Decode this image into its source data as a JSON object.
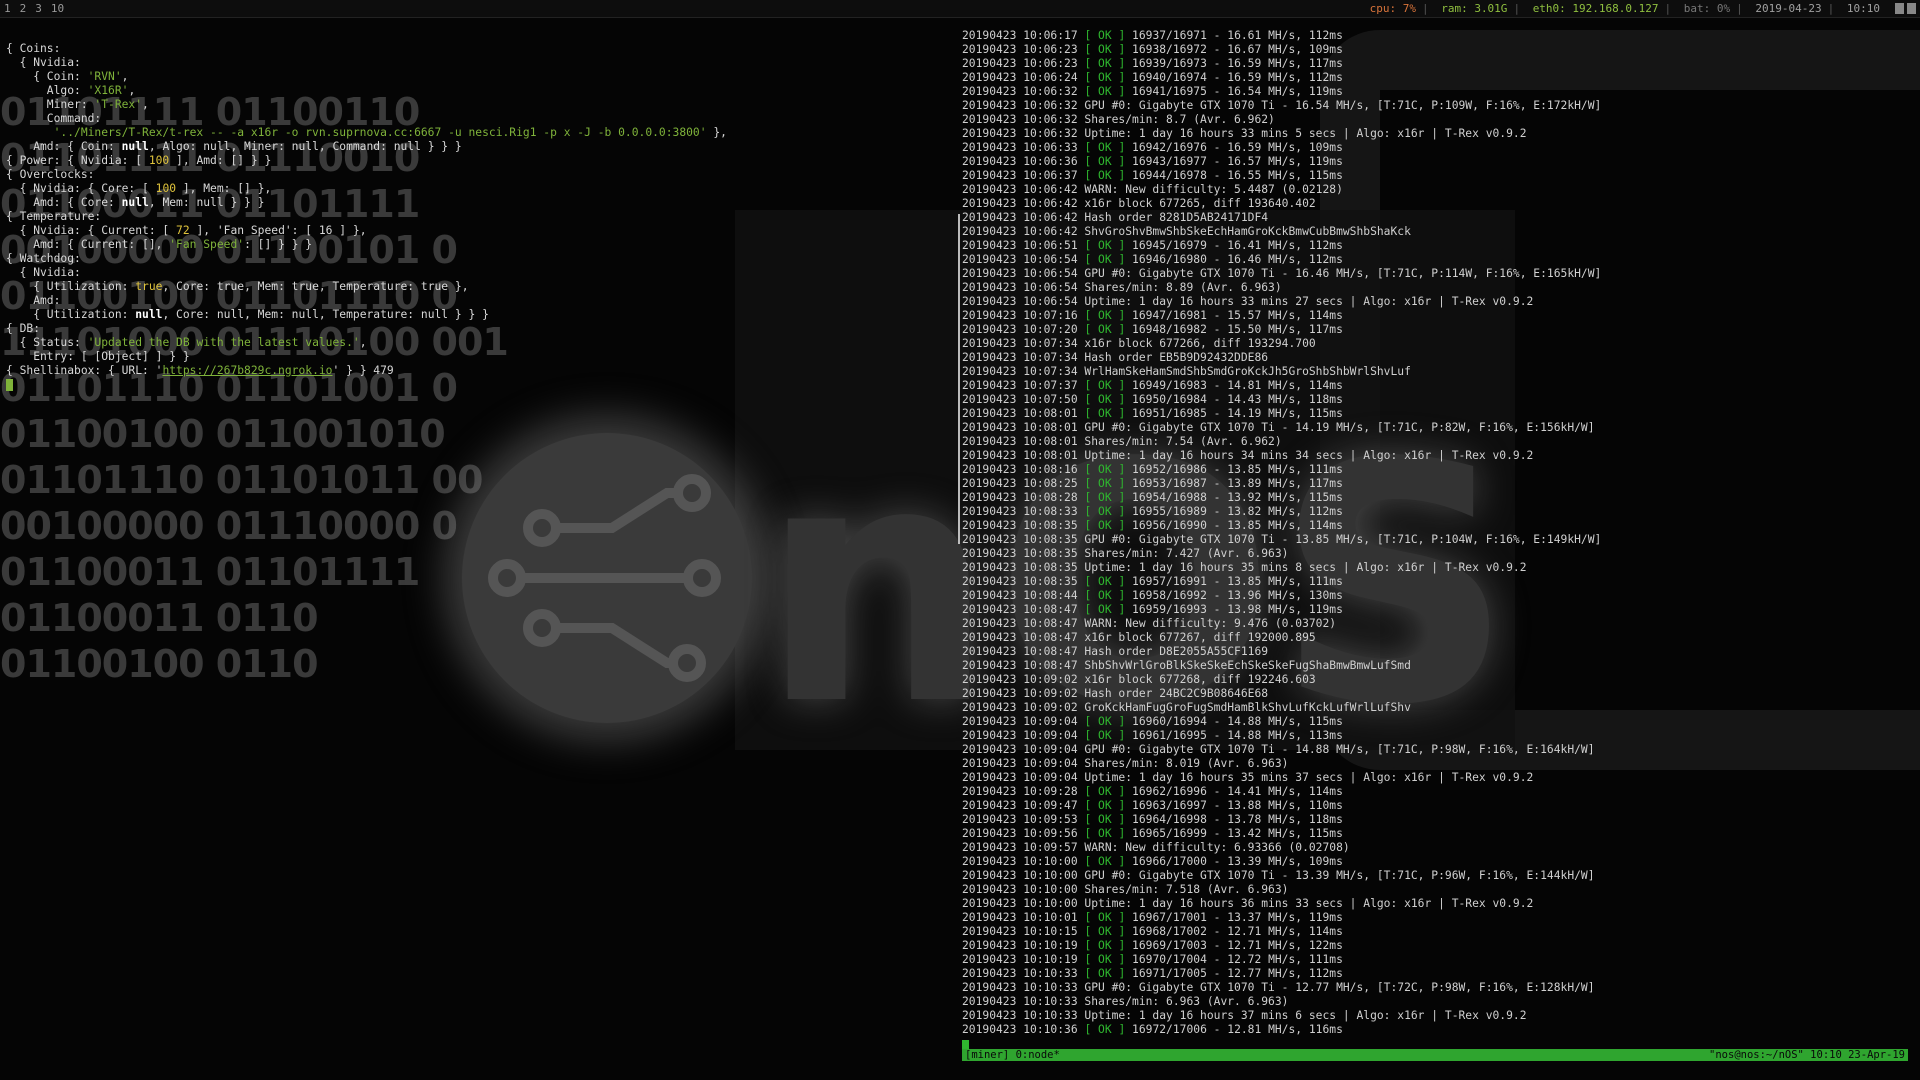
{
  "topbar": {
    "workspaces": [
      "1",
      "2",
      "3",
      "10"
    ],
    "cpu": "cpu: 7%",
    "ram": "ram: 3.01G",
    "eth": "eth0: 192.168.0.127",
    "bat": "bat: 0%",
    "date": "2019-04-23",
    "time": "10:10",
    "colors": {
      "cpu": "#d8733a",
      "ram": "#8fbf3f"
    }
  },
  "wallpaper": {
    "logo_text": "nOS",
    "binary_rows": [
      "01101111 01100110",
      "01101111 01110010",
      "01100011 01101111",
      "00100000 01100101 0",
      "01100100 01101110 0",
      "11101000 01110100 001",
      "01101110 01101001 0",
      "01100100 011001010",
      "01101110 01101011 00",
      "00100000 01110000 0",
      "01100011 01101111",
      "01100011 0110",
      "01100100 0110"
    ]
  },
  "left_pane": {
    "lines": [
      {
        "t": "{ Coins:"
      },
      {
        "t": "  { Nvidia:"
      },
      {
        "t": "    { Coin: ",
        "s": "'RVN'",
        "e": ","
      },
      {
        "t": "      Algo: ",
        "s": "'X16R'",
        "e": ","
      },
      {
        "t": "      Miner: ",
        "s": "'T-Rex'",
        "e": ","
      },
      {
        "t": "      Command:"
      },
      {
        "t": "       ",
        "s": "'../Miners/T-Rex/t-rex -- -a x16r -o rvn.suprnova.cc:6667 -u nesci.Rig1 -p x -J -b 0.0.0.0:3800'",
        "e": " },"
      },
      {
        "t": "    Amd: { Coin: ",
        "b": "null",
        "e": ", Algo: null, Miner: null, Command: null } } }"
      },
      {
        "t": "{ Power: { Nvidia: [ ",
        "n": "100",
        "e": " ], Amd: [] } }"
      },
      {
        "t": "{ Overclocks:"
      },
      {
        "t": "  { Nvidia: { Core: [ ",
        "n": "100",
        "e": " ], Mem: [] },"
      },
      {
        "t": "    Amd: { Core: ",
        "b": "null",
        "e": ", Mem: null } } }"
      },
      {
        "t": "{ Temperature:"
      },
      {
        "t": "  { Nvidia: { Current: [ ",
        "n": "72",
        "e": " ], 'Fan Speed': [ 16 ] },"
      },
      {
        "t": "    Amd: { Current: [], ",
        "s": "'Fan Speed'",
        "e": ": [] } } }"
      },
      {
        "t": "{ Watchdog:"
      },
      {
        "t": "  { Nvidia:"
      },
      {
        "t": "    { Utilization: ",
        "n": "true",
        "e": ", Core: true, Mem: true, Temperature: true },"
      },
      {
        "t": "    Amd:"
      },
      {
        "t": "    { Utilization: ",
        "b": "null",
        "e": ", Core: null, Mem: null, Temperature: null } } }"
      },
      {
        "t": "{ DB:"
      },
      {
        "t": "  { Status: ",
        "s": "'Updated the DB with the latest values.'",
        "e": ","
      },
      {
        "t": "    Entry: [ [Object] ] } }"
      },
      {
        "t": "{ Shellinabox: { URL: '",
        "u": "https://267b829c.ngrok.io",
        "e": "' } } 479"
      }
    ]
  },
  "right_pane": {
    "lines": [
      "20190423 10:06:17 [ OK ] 16937/16971 - 16.61 MH/s, 112ms",
      "20190423 10:06:23 [ OK ] 16938/16972 - 16.67 MH/s, 109ms",
      "20190423 10:06:23 [ OK ] 16939/16973 - 16.59 MH/s, 117ms",
      "20190423 10:06:24 [ OK ] 16940/16974 - 16.59 MH/s, 112ms",
      "20190423 10:06:32 [ OK ] 16941/16975 - 16.54 MH/s, 119ms",
      "20190423 10:06:32 GPU #0: Gigabyte GTX 1070 Ti - 16.54 MH/s, [T:71C, P:109W, F:16%, E:172kH/W]",
      "20190423 10:06:32 Shares/min: 8.7 (Avr. 6.962)",
      "20190423 10:06:32 Uptime: 1 day 16 hours 33 mins 5 secs | Algo: x16r | T-Rex v0.9.2",
      "20190423 10:06:33 [ OK ] 16942/16976 - 16.59 MH/s, 109ms",
      "20190423 10:06:36 [ OK ] 16943/16977 - 16.57 MH/s, 119ms",
      "20190423 10:06:37 [ OK ] 16944/16978 - 16.55 MH/s, 115ms",
      "20190423 10:06:42 WARN: New difficulty: 5.4487 (0.02128)",
      "20190423 10:06:42 x16r block 677265, diff 193640.402",
      "20190423 10:06:42 Hash order 8281D5AB24171DF4",
      "20190423 10:06:42 ShvGroShvBmwShbSkeEchHamGroKckBmwCubBmwShbShaKck",
      "20190423 10:06:51 [ OK ] 16945/16979 - 16.41 MH/s, 112ms",
      "20190423 10:06:54 [ OK ] 16946/16980 - 16.46 MH/s, 112ms",
      "20190423 10:06:54 GPU #0: Gigabyte GTX 1070 Ti - 16.46 MH/s, [T:71C, P:114W, F:16%, E:165kH/W]",
      "20190423 10:06:54 Shares/min: 8.89 (Avr. 6.963)",
      "20190423 10:06:54 Uptime: 1 day 16 hours 33 mins 27 secs | Algo: x16r | T-Rex v0.9.2",
      "20190423 10:07:16 [ OK ] 16947/16981 - 15.57 MH/s, 114ms",
      "20190423 10:07:20 [ OK ] 16948/16982 - 15.50 MH/s, 117ms",
      "20190423 10:07:34 x16r block 677266, diff 193294.700",
      "20190423 10:07:34 Hash order EB5B9D92432DDE86",
      "20190423 10:07:34 WrlHamSkeHamSmdShbSmdGroKckJh5GroShbShbWrlShvLuf",
      "20190423 10:07:37 [ OK ] 16949/16983 - 14.81 MH/s, 114ms",
      "20190423 10:07:50 [ OK ] 16950/16984 - 14.43 MH/s, 118ms",
      "20190423 10:08:01 [ OK ] 16951/16985 - 14.19 MH/s, 115ms",
      "20190423 10:08:01 GPU #0: Gigabyte GTX 1070 Ti - 14.19 MH/s, [T:71C, P:82W, F:16%, E:156kH/W]",
      "20190423 10:08:01 Shares/min: 7.54 (Avr. 6.962)",
      "20190423 10:08:01 Uptime: 1 day 16 hours 34 mins 34 secs | Algo: x16r | T-Rex v0.9.2",
      "20190423 10:08:16 [ OK ] 16952/16986 - 13.85 MH/s, 111ms",
      "20190423 10:08:25 [ OK ] 16953/16987 - 13.89 MH/s, 117ms",
      "20190423 10:08:28 [ OK ] 16954/16988 - 13.92 MH/s, 115ms",
      "20190423 10:08:33 [ OK ] 16955/16989 - 13.82 MH/s, 112ms",
      "20190423 10:08:35 [ OK ] 16956/16990 - 13.85 MH/s, 114ms",
      "20190423 10:08:35 GPU #0: Gigabyte GTX 1070 Ti - 13.85 MH/s, [T:71C, P:104W, F:16%, E:149kH/W]",
      "20190423 10:08:35 Shares/min: 7.427 (Avr. 6.963)",
      "20190423 10:08:35 Uptime: 1 day 16 hours 35 mins 8 secs | Algo: x16r | T-Rex v0.9.2",
      "20190423 10:08:35 [ OK ] 16957/16991 - 13.85 MH/s, 111ms",
      "20190423 10:08:44 [ OK ] 16958/16992 - 13.96 MH/s, 130ms",
      "20190423 10:08:47 [ OK ] 16959/16993 - 13.98 MH/s, 119ms",
      "20190423 10:08:47 WARN: New difficulty: 9.476 (0.03702)",
      "20190423 10:08:47 x16r block 677267, diff 192000.895",
      "20190423 10:08:47 Hash order D8E2055A55CF1169",
      "20190423 10:08:47 ShbShvWrlGroBlkSkeSkeEchSkeSkeFugShaBmwBmwLufSmd",
      "20190423 10:09:02 x16r block 677268, diff 192246.603",
      "20190423 10:09:02 Hash order 24BC2C9B08646E68",
      "20190423 10:09:02 GroKckHamFugGroFugSmdHamBlkShvLufKckLufWrlLufShv",
      "20190423 10:09:04 [ OK ] 16960/16994 - 14.88 MH/s, 115ms",
      "20190423 10:09:04 [ OK ] 16961/16995 - 14.88 MH/s, 113ms",
      "20190423 10:09:04 GPU #0: Gigabyte GTX 1070 Ti - 14.88 MH/s, [T:71C, P:98W, F:16%, E:164kH/W]",
      "20190423 10:09:04 Shares/min: 8.019 (Avr. 6.963)",
      "20190423 10:09:04 Uptime: 1 day 16 hours 35 mins 37 secs | Algo: x16r | T-Rex v0.9.2",
      "20190423 10:09:28 [ OK ] 16962/16996 - 14.41 MH/s, 114ms",
      "20190423 10:09:47 [ OK ] 16963/16997 - 13.88 MH/s, 110ms",
      "20190423 10:09:53 [ OK ] 16964/16998 - 13.78 MH/s, 118ms",
      "20190423 10:09:56 [ OK ] 16965/16999 - 13.42 MH/s, 115ms",
      "20190423 10:09:57 WARN: New difficulty: 6.93366 (0.02708)",
      "20190423 10:10:00 [ OK ] 16966/17000 - 13.39 MH/s, 109ms",
      "20190423 10:10:00 GPU #0: Gigabyte GTX 1070 Ti - 13.39 MH/s, [T:71C, P:96W, F:16%, E:144kH/W]",
      "20190423 10:10:00 Shares/min: 7.518 (Avr. 6.963)",
      "20190423 10:10:00 Uptime: 1 day 16 hours 36 mins 33 secs | Algo: x16r | T-Rex v0.9.2",
      "20190423 10:10:01 [ OK ] 16967/17001 - 13.37 MH/s, 119ms",
      "20190423 10:10:15 [ OK ] 16968/17002 - 12.71 MH/s, 114ms",
      "20190423 10:10:19 [ OK ] 16969/17003 - 12.71 MH/s, 122ms",
      "20190423 10:10:19 [ OK ] 16970/17004 - 12.72 MH/s, 111ms",
      "20190423 10:10:33 [ OK ] 16971/17005 - 12.77 MH/s, 112ms",
      "20190423 10:10:33 GPU #0: Gigabyte GTX 1070 Ti - 12.77 MH/s, [T:72C, P:98W, F:16%, E:128kH/W]",
      "20190423 10:10:33 Shares/min: 6.963 (Avr. 6.963)",
      "20190423 10:10:33 Uptime: 1 day 16 hours 37 mins 6 secs | Algo: x16r | T-Rex v0.9.2",
      "20190423 10:10:36 [ OK ] 16972/17006 - 12.81 MH/s, 116ms"
    ]
  },
  "tmux": {
    "left": "[miner] 0:node*",
    "right": "\"nos@nos:~/nOS\" 10:10 23-Apr-19"
  }
}
